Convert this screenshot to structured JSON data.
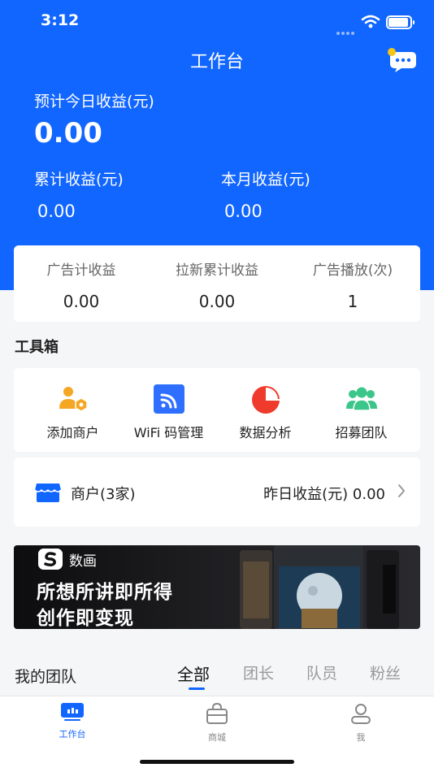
{
  "status_bar": {
    "time": "3:12"
  },
  "header": {
    "title": "工作台"
  },
  "earnings": {
    "estimated_today_label": "预计今日收益(元)",
    "estimated_today_value": "0.00",
    "accumulated_label": "累计收益(元)",
    "accumulated_value": "0.00",
    "month_label": "本月收益(元)",
    "month_value": "0.00"
  },
  "stats": [
    {
      "label": "广告计收益",
      "value": "0.00"
    },
    {
      "label": "拉新累计收益",
      "value": "0.00"
    },
    {
      "label": "广告播放(次)",
      "value": "1"
    }
  ],
  "toolbox": {
    "title": "工具箱",
    "items": [
      {
        "label": "添加商户",
        "icon": "add-merchant-icon"
      },
      {
        "label": "WiFi 码管理",
        "icon": "wifi-code-icon"
      },
      {
        "label": "数据分析",
        "icon": "pie-chart-icon"
      },
      {
        "label": "招募团队",
        "icon": "team-icon"
      }
    ]
  },
  "merchant": {
    "name": "商户(3家)",
    "yesterday": "昨日收益(元) 0.00"
  },
  "banner": {
    "brand": "数画",
    "line1": "所想所讲即所得",
    "line2": "创作即变现"
  },
  "team": {
    "title": "我的团队",
    "tabs": [
      "全部",
      "团长",
      "队员",
      "粉丝"
    ],
    "active_tab": "全部"
  },
  "tabbar": {
    "items": [
      {
        "label": "工作台",
        "icon": "workbench-icon",
        "active": true
      },
      {
        "label": "商城",
        "icon": "shop-bag-icon",
        "active": false
      },
      {
        "label": "我",
        "icon": "user-icon",
        "active": false
      }
    ]
  },
  "colors": {
    "primary": "#1166ff",
    "orange": "#f5a623",
    "red": "#ef3b2c",
    "green": "#3cc68a"
  }
}
